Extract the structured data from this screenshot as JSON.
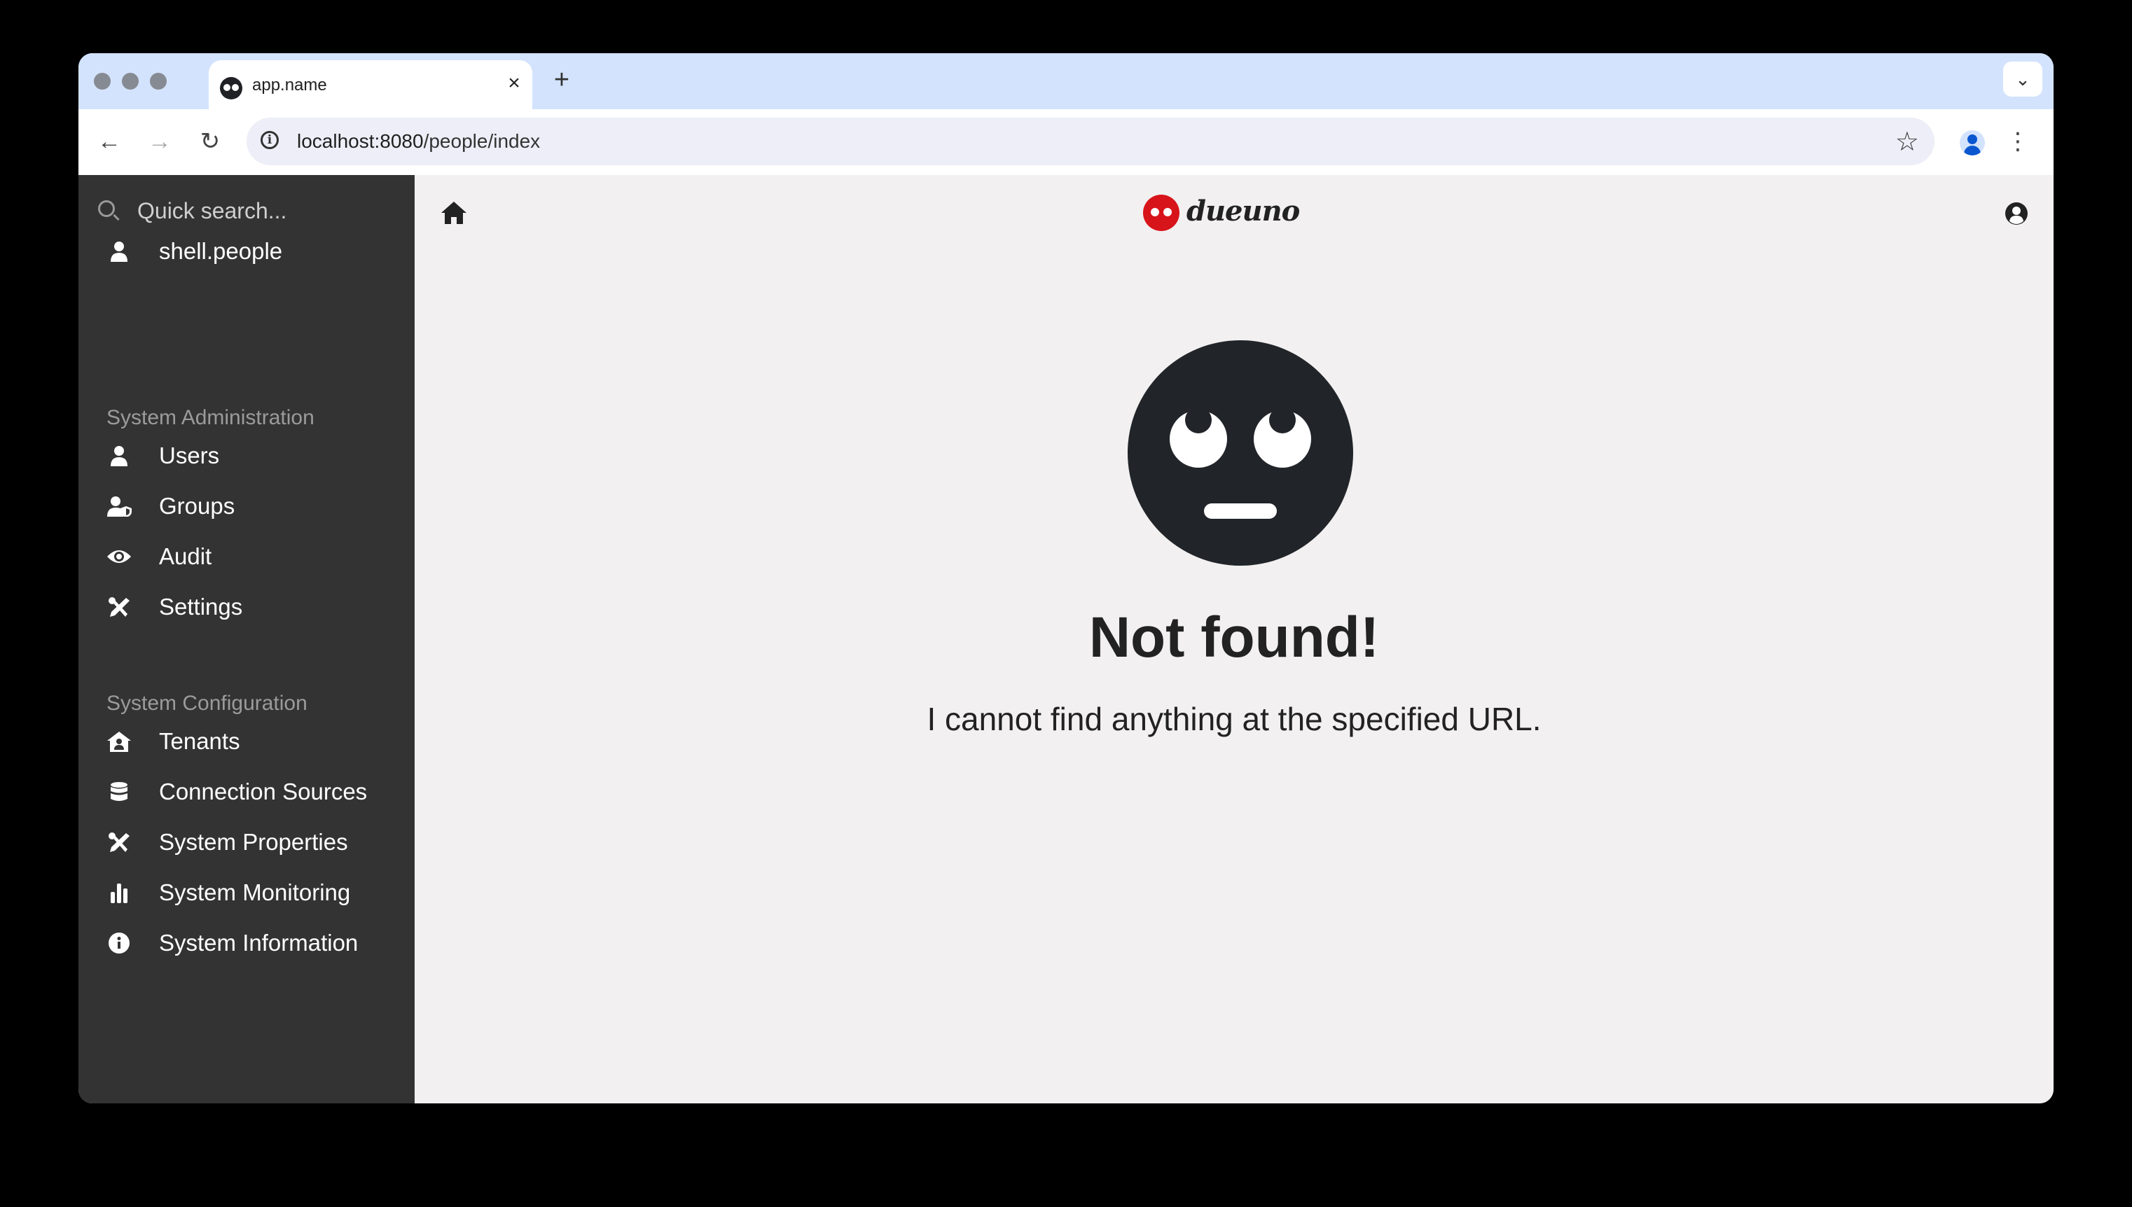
{
  "browser": {
    "tab_title": "app.name",
    "url_host": "localhost:8080",
    "url_path": "/people/index"
  },
  "sidebar": {
    "search_placeholder": "Quick search...",
    "top_items": [
      {
        "label": "shell.people",
        "icon": "user-icon"
      }
    ],
    "sections": [
      {
        "title": "System Administration",
        "items": [
          {
            "label": "Users",
            "icon": "user-icon"
          },
          {
            "label": "Groups",
            "icon": "user-shield-icon"
          },
          {
            "label": "Audit",
            "icon": "eye-icon"
          },
          {
            "label": "Settings",
            "icon": "tools-icon"
          }
        ]
      },
      {
        "title": "System Configuration",
        "items": [
          {
            "label": "Tenants",
            "icon": "house-user-icon"
          },
          {
            "label": "Connection Sources",
            "icon": "database-icon"
          },
          {
            "label": "System Properties",
            "icon": "tools-icon"
          },
          {
            "label": "System Monitoring",
            "icon": "bar-chart-icon"
          },
          {
            "label": "System Information",
            "icon": "info-circle-icon"
          }
        ]
      }
    ]
  },
  "header": {
    "brand_name": "dueuno",
    "brand_color": "#d7141a"
  },
  "main": {
    "icon": "face-rolling-eyes-icon",
    "title": "Not found!",
    "message": "I cannot find anything at the specified URL."
  },
  "colors": {
    "sidebar_bg": "#333333",
    "content_bg": "#f2f0f0",
    "tabstrip_bg": "#d3e3fd"
  }
}
